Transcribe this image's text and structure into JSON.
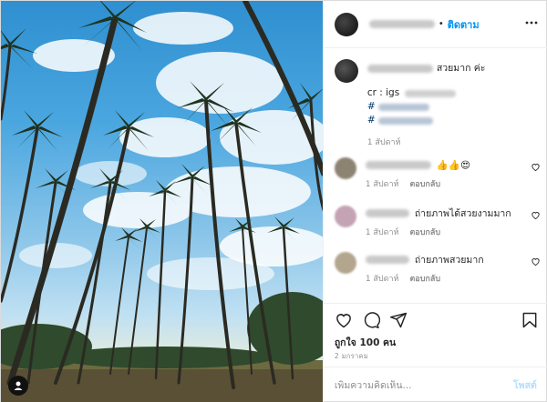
{
  "header": {
    "follow_label": "ติดตาม",
    "dot": "•"
  },
  "caption": {
    "text": "สวยมาก ค่ะ",
    "credit_prefix": "cr : igs",
    "hashtag1": "#",
    "hashtag2": "#",
    "time": "1 สัปดาห์"
  },
  "comments": [
    {
      "text": "👍👍😍",
      "time": "1 สัปดาห์",
      "reply_label": "ตอบกลับ"
    },
    {
      "text": "ถ่ายภาพได้สวยงามมาก",
      "time": "1 สัปดาห์",
      "reply_label": "ตอบกลับ"
    },
    {
      "text": "ถ่ายภาพสวยมาก",
      "time": "1 สัปดาห์",
      "reply_label": "ตอบกลับ"
    }
  ],
  "likes_label": "ถูกใจ 100 คน",
  "date_label": "2 มกราคม",
  "comment_input": {
    "placeholder": "เพิ่มความคิดเห็น...",
    "post_label": "โพสต์"
  },
  "icons": [
    "user-icon",
    "more-options-icon",
    "heart-icon",
    "comment-icon",
    "share-icon",
    "bookmark-icon"
  ],
  "colors": {
    "link_blue": "#0095f6",
    "post_disabled": "#b2dffc",
    "hashtag": "#00376b"
  }
}
